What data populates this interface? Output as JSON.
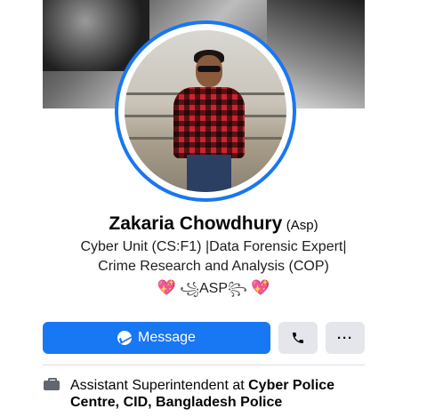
{
  "profile": {
    "name": "Zakaria Chowdhury",
    "name_suffix": "(Asp)",
    "bio_line1": "Cyber Unit (CS:F1) |Data Forensic Expert|",
    "bio_line2": "Crime Research and Analysis (COP)",
    "decor_text": "ASP",
    "decor_heart": "💖",
    "decor_swirl_left": "꧁",
    "decor_swirl_right": "꧂"
  },
  "actions": {
    "message_label": "Message",
    "message_icon": "messenger-icon",
    "call_icon": "phone-icon",
    "more_label": "···"
  },
  "work": {
    "icon": "briefcase-icon",
    "prefix": "Assistant Superintendent at ",
    "employer": "Cyber Police Centre, CID, Bangladesh Police"
  },
  "colors": {
    "accent": "#1877f2",
    "gray_button": "#e4e6eb"
  }
}
